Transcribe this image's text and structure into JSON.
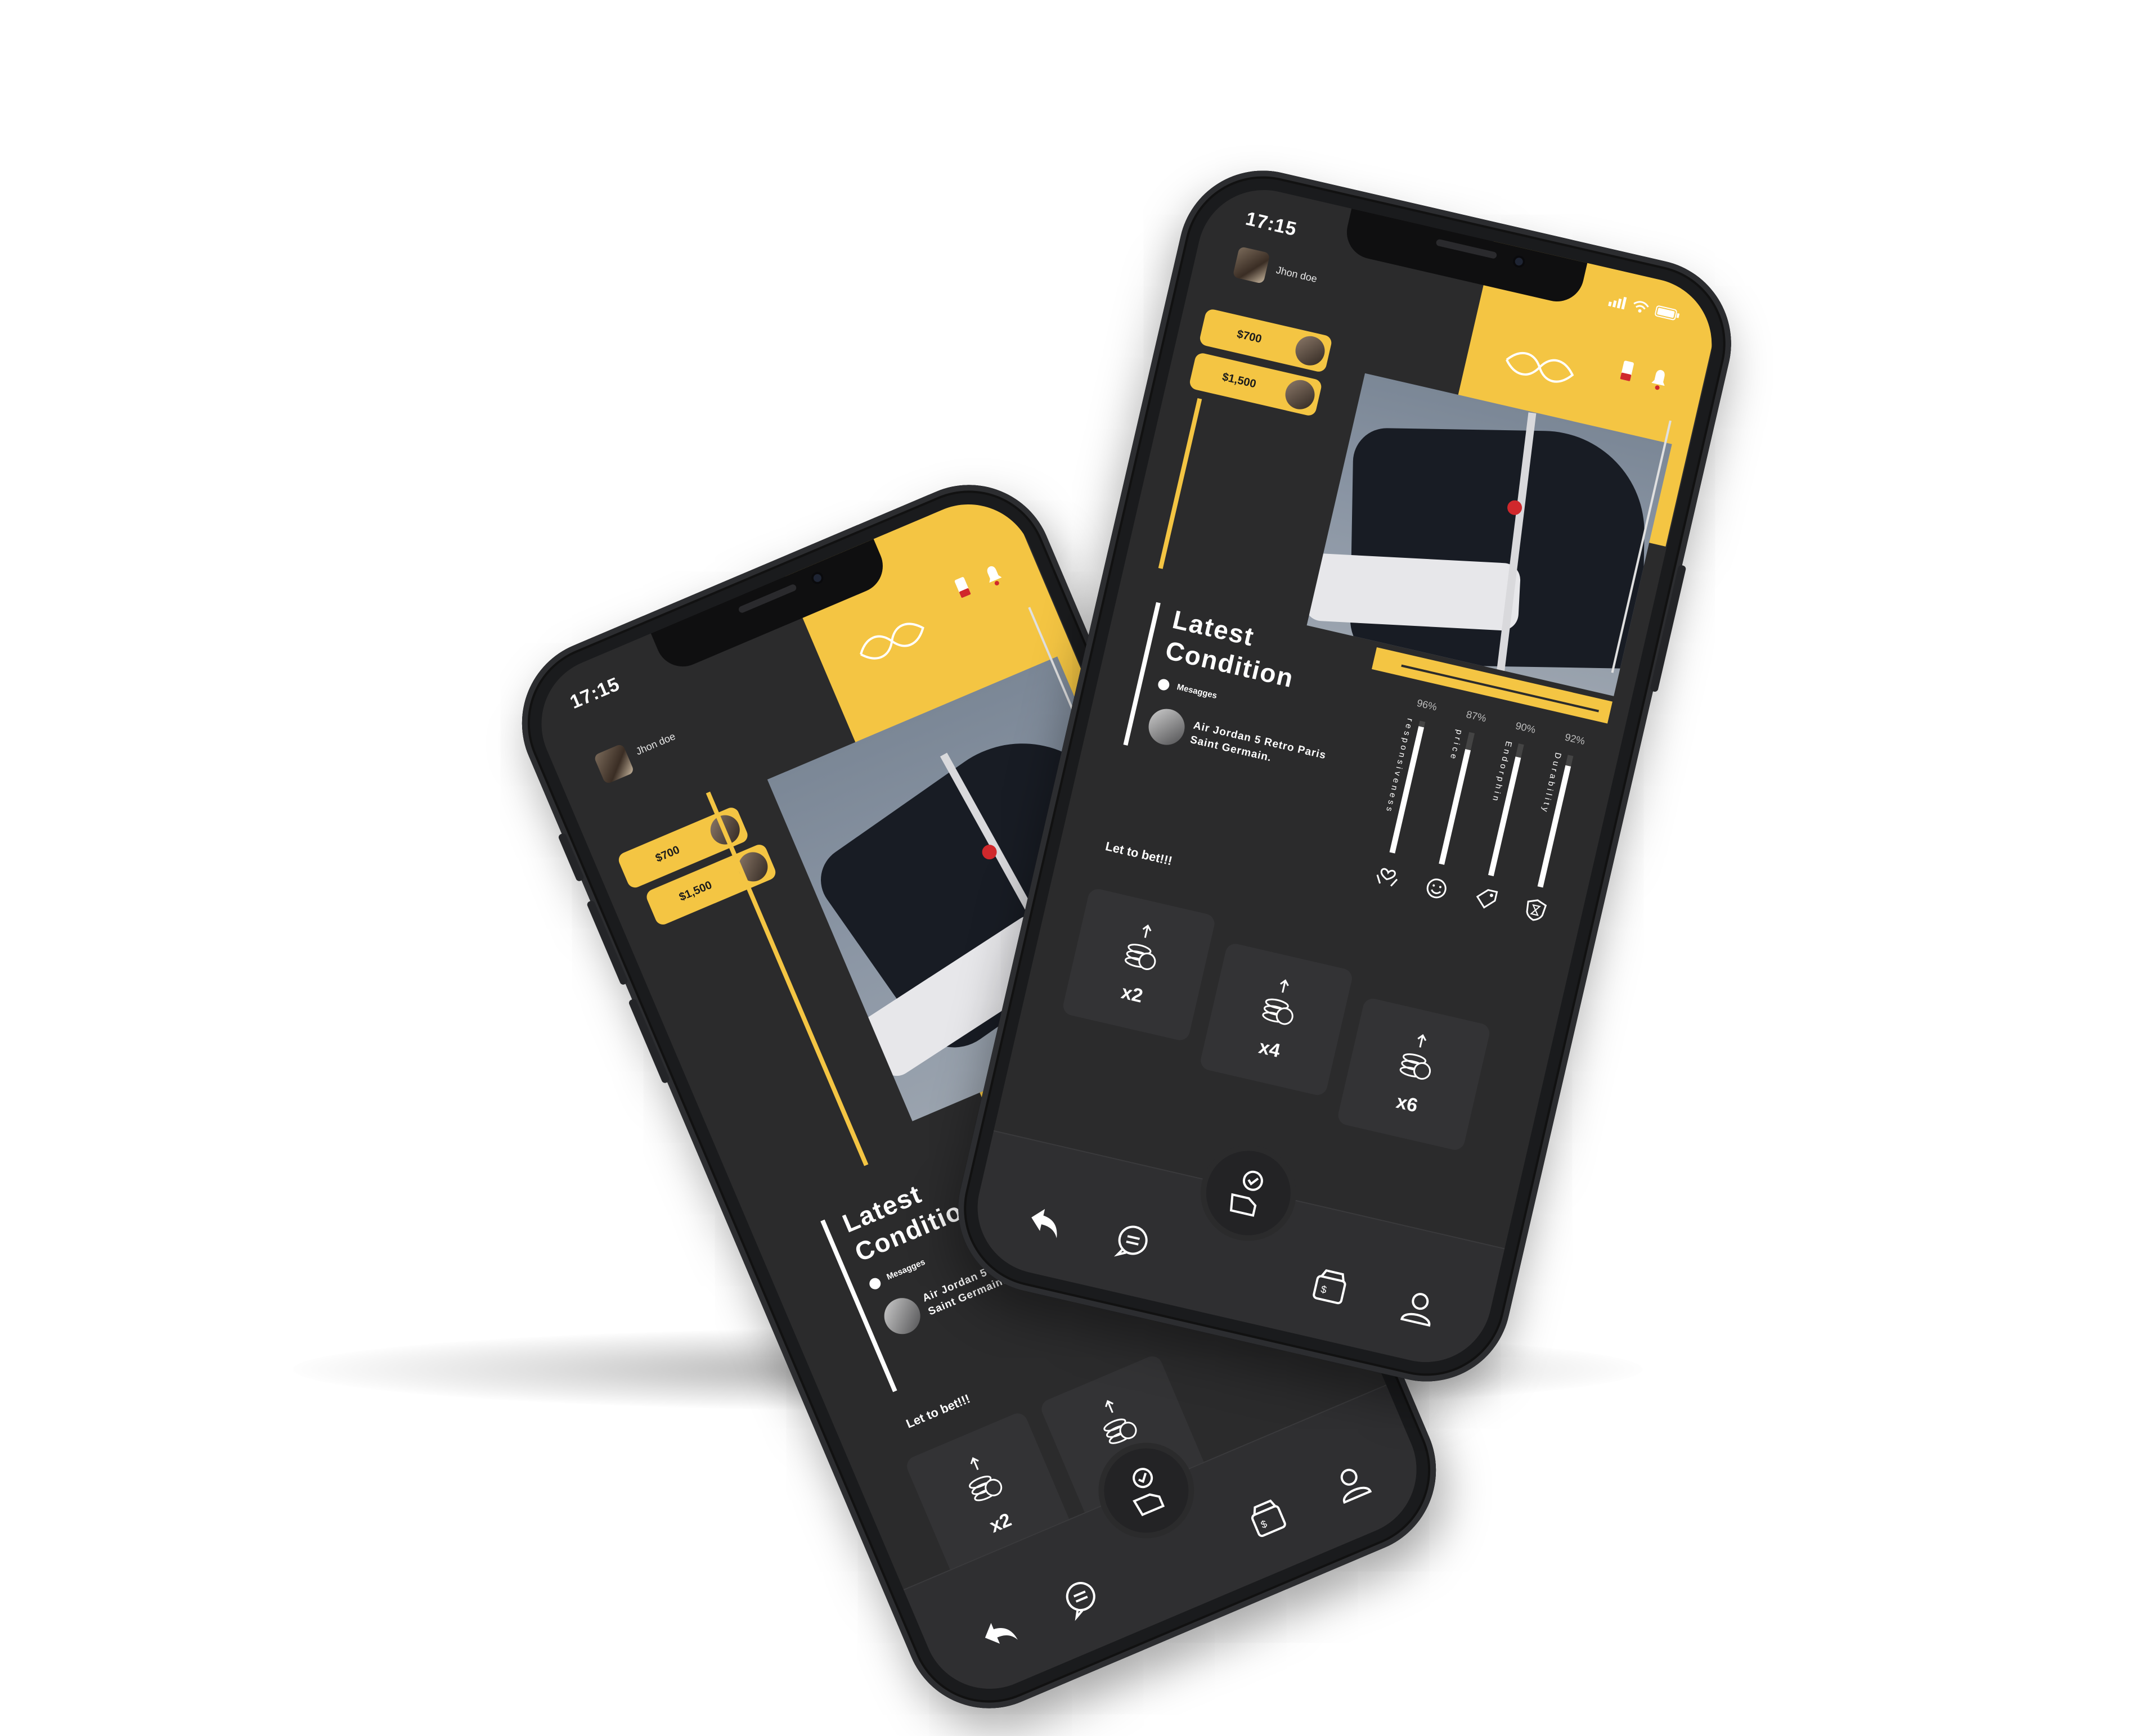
{
  "brand": {
    "accent": "#f4c543",
    "screen_bg": "#2b2b2c",
    "tile_bg": "#333335",
    "text": "#ffffff"
  },
  "status_bar": {
    "time": "17:15",
    "icons": [
      "signal-icon",
      "wifi-icon",
      "battery-icon"
    ]
  },
  "header": {
    "username": "Jhon doe",
    "logo": "infinity-logo-icon",
    "icons": [
      "battery-alert-icon",
      "bell-icon"
    ]
  },
  "bets": [
    {
      "amount": "$700"
    },
    {
      "amount": "$1,500"
    }
  ],
  "condition": {
    "title": "Latest Condition",
    "messages_label": "Mesagges",
    "product": "Air Jordan 5 Retro Paris Saint Germain."
  },
  "stats": [
    {
      "label": "responsiveness",
      "value": 96,
      "pct": "96%",
      "icon": "hands-heart-icon"
    },
    {
      "label": "price",
      "value": 87,
      "pct": "87%",
      "icon": "smiley-icon"
    },
    {
      "label": "Endorphin",
      "value": 90,
      "pct": "90%",
      "icon": "price-tag-icon"
    },
    {
      "label": "Durability",
      "value": 92,
      "pct": "92%",
      "icon": "hourglass-shield-icon"
    }
  ],
  "bet_section": {
    "label": "Let to bet!!!",
    "multipliers": [
      {
        "label": "x2"
      },
      {
        "label": "x4"
      },
      {
        "label": "x6"
      }
    ]
  },
  "nav": {
    "items": [
      "back-arrow-icon",
      "chat-icon",
      "approve-hand-icon",
      "wallet-icon",
      "profile-icon"
    ]
  }
}
